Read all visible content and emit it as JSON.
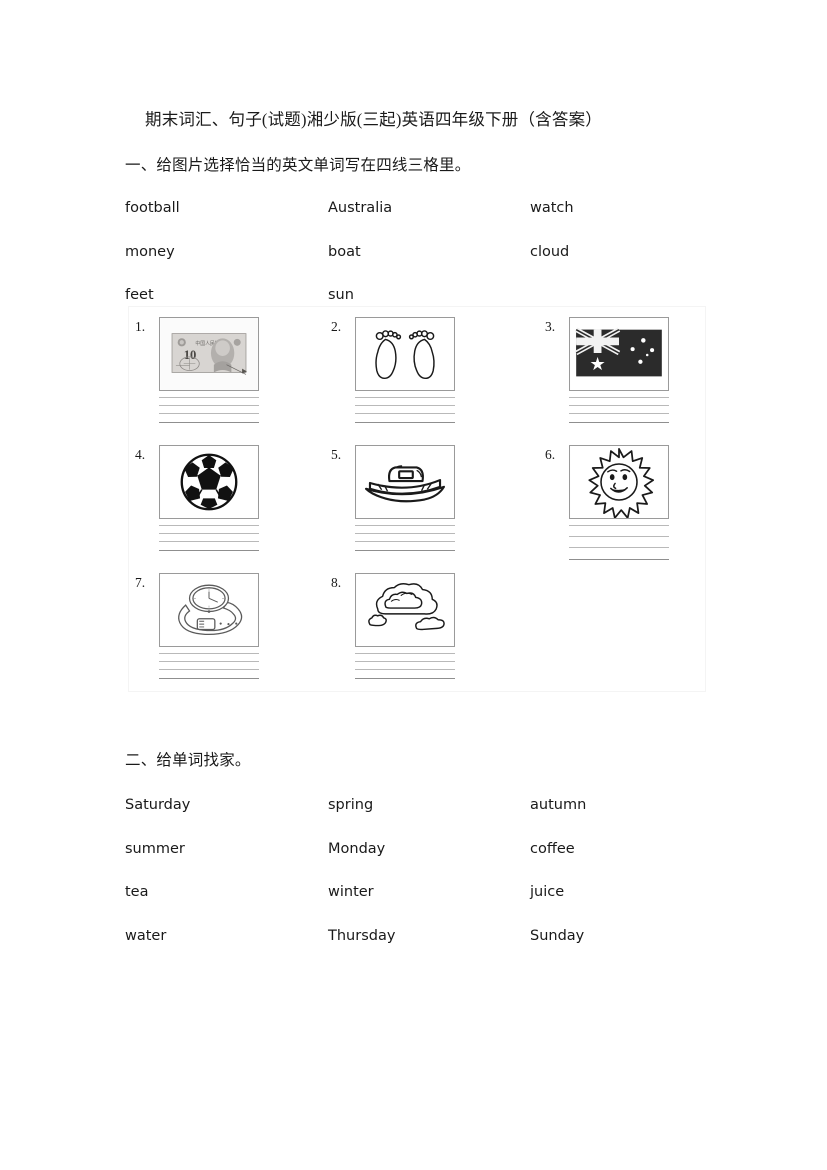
{
  "document": {
    "title": "期末词汇、句子(试题)湘少版(三起)英语四年级下册（含答案）"
  },
  "section1": {
    "heading": "一、给图片选择恰当的英文单词写在四线三格里。",
    "word_bank": [
      [
        "football",
        "Australia",
        "watch"
      ],
      [
        "money",
        "boat",
        "cloud"
      ],
      [
        "feet",
        "sun",
        ""
      ]
    ],
    "items": [
      {
        "number": "1.",
        "picture": "chinese-banknote-10-yuan-icon",
        "answer_word": "money"
      },
      {
        "number": "2.",
        "picture": "bare-feet-icon",
        "answer_word": "feet"
      },
      {
        "number": "3.",
        "picture": "australian-flag-icon",
        "answer_word": "Australia"
      },
      {
        "number": "4.",
        "picture": "soccer-ball-icon",
        "answer_word": "football"
      },
      {
        "number": "5.",
        "picture": "boat-icon",
        "answer_word": "boat"
      },
      {
        "number": "6.",
        "picture": "smiling-sun-icon",
        "answer_word": "sun"
      },
      {
        "number": "7.",
        "picture": "wristwatch-icon",
        "answer_word": "watch"
      },
      {
        "number": "8.",
        "picture": "clouds-icon",
        "answer_word": "cloud"
      }
    ]
  },
  "section2": {
    "heading": "二、给单词找家。",
    "word_bank": [
      [
        "Saturday",
        "spring",
        "autumn"
      ],
      [
        "summer",
        "Monday",
        "coffee"
      ],
      [
        "tea",
        "winter",
        "juice"
      ],
      [
        "water",
        "Thursday",
        "Sunday"
      ]
    ]
  }
}
